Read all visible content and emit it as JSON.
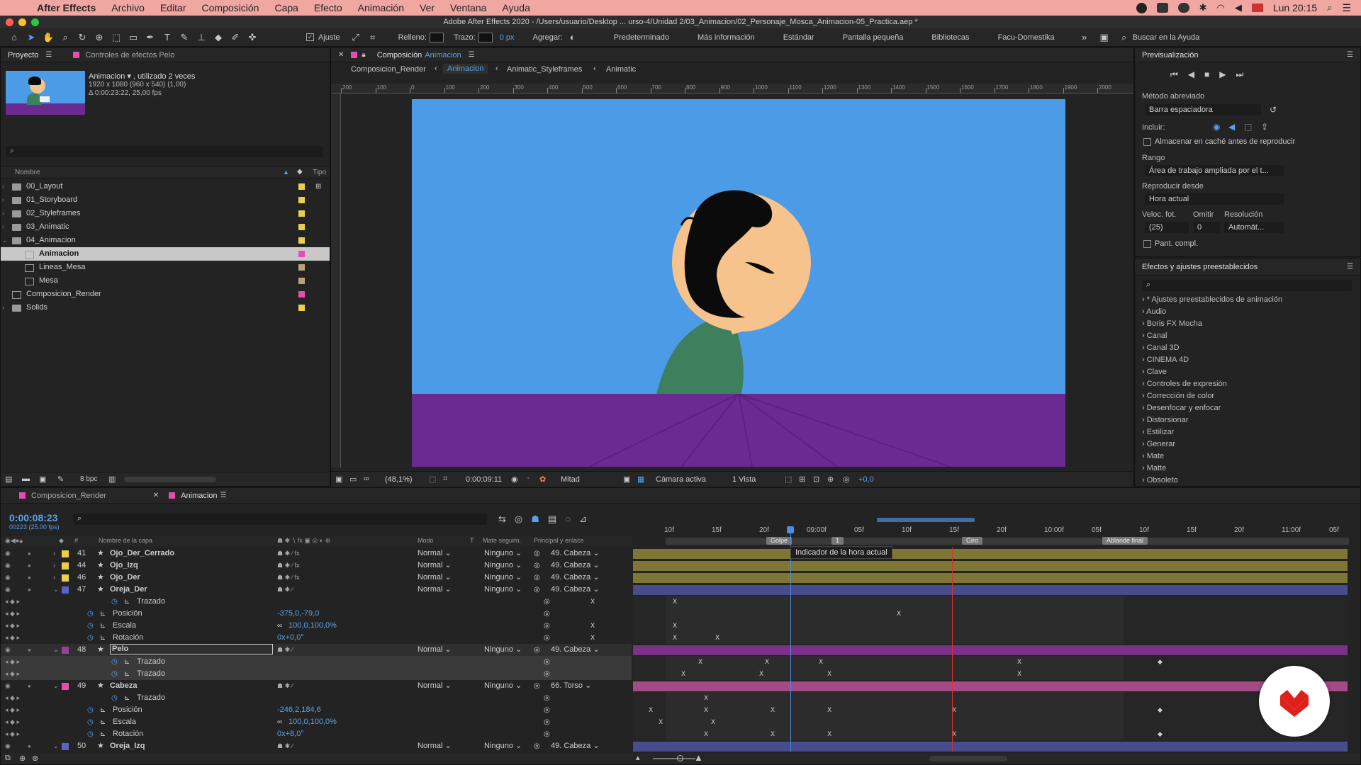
{
  "menubar": {
    "app": "After Effects",
    "items": [
      "Archivo",
      "Editar",
      "Composición",
      "Capa",
      "Efecto",
      "Animación",
      "Ver",
      "Ventana",
      "Ayuda"
    ],
    "clock": "Lun 20:15"
  },
  "titlebar": {
    "title": "Adobe After Effects 2020 - /Users/usuario/Desktop ... urso-4/Unidad 2/03_Animacion/02_Personaje_Mosca_Animacion-05_Practica.aep *"
  },
  "toolbar": {
    "ajuste": "Ajuste",
    "relleno": "Relleno:",
    "trazo": "Trazo:",
    "trazo_px": "0 px",
    "agregar": "Agregar:",
    "workspaces": [
      "Predeterminado",
      "Más información",
      "Estándar",
      "Pantalla pequeña",
      "Bibliotecas",
      "Facu-Domestika"
    ],
    "search_placeholder": "Buscar en la Ayuda"
  },
  "project": {
    "tab_project": "Proyecto",
    "tab_effects": "Controles de efectos Pelo",
    "selected_name": "Animacion ▾ , utilizado 2 veces",
    "selected_size": "1920 x 1080  (960 x 540) (1,00)",
    "selected_duration": "Δ 0:00:23:22, 25,00 fps",
    "col_name": "Nombre",
    "col_type": "Tipo",
    "bpc": "8 bpc",
    "items": [
      {
        "name": "00_Layout",
        "kind": "folder",
        "indent": 0,
        "color": "#e8d04c"
      },
      {
        "name": "01_Storyboard",
        "kind": "folder",
        "indent": 0,
        "color": "#e8d04c"
      },
      {
        "name": "02_Styleframes",
        "kind": "folder",
        "indent": 0,
        "color": "#e8d04c"
      },
      {
        "name": "03_Animatic",
        "kind": "folder",
        "indent": 0,
        "color": "#e8d04c"
      },
      {
        "name": "04_Animacion",
        "kind": "folder-open",
        "indent": 0,
        "color": "#e8d04c"
      },
      {
        "name": "Animacion",
        "kind": "comp",
        "indent": 1,
        "color": "#e64db2",
        "selected": true
      },
      {
        "name": "Lineas_Mesa",
        "kind": "comp",
        "indent": 1,
        "color": "#b8a37a"
      },
      {
        "name": "Mesa",
        "kind": "comp",
        "indent": 1,
        "color": "#b8a37a"
      },
      {
        "name": "Composicion_Render",
        "kind": "comp",
        "indent": 0,
        "color": "#e64db2"
      },
      {
        "name": "Solids",
        "kind": "folder",
        "indent": 0,
        "color": "#e8d04c"
      }
    ]
  },
  "viewer": {
    "tab_label": "Composición",
    "tab_comp": "Animacion",
    "crumbs": [
      "Composicion_Render",
      "Animacion",
      "Animatic_Styleframes",
      "Animatic"
    ],
    "ruler_labels": [
      "200",
      "100",
      "0",
      "100",
      "200",
      "300",
      "400",
      "500",
      "600",
      "700",
      "800",
      "900",
      "1000",
      "1100",
      "1200",
      "1300",
      "1400",
      "1500",
      "1600",
      "1700",
      "1800",
      "1900",
      "2000"
    ],
    "zoom": "(48,1%)",
    "timecode": "0:00:09:11",
    "resolution": "Mitad",
    "camera": "Cámara activa",
    "views": "1 Vista",
    "exposure": "+0,0",
    "colors": {
      "sky": "#4c9be6",
      "table": "#6a2a92",
      "skin": "#f5c38b",
      "hair": "#0b0b0b",
      "shirt": "#3e7f5e"
    }
  },
  "preview": {
    "title": "Previsualización",
    "metodo_label": "Método abreviado",
    "metodo_value": "Barra espaciadora",
    "incluir_label": "Incluir:",
    "cache_label": "Almacenar en caché antes de reproducir",
    "rango_label": "Rango",
    "rango_value": "Área de trabajo ampliada por el t...",
    "reproducir_label": "Reproducir desde",
    "reproducir_value": "Hora actual",
    "veloc_label": "Veloc. fot.",
    "omitir_label": "Omitir",
    "resolucion_label": "Resolución",
    "veloc_value": "(25)",
    "omitir_value": "0",
    "resolucion_value": "Automát...",
    "pant_label": "Pant. compl."
  },
  "effects": {
    "title": "Efectos y ajustes preestablecidos",
    "items": [
      "* Ajustes preestablecidos de animación",
      "Audio",
      "Boris FX Mocha",
      "Canal",
      "Canal 3D",
      "CINEMA 4D",
      "Clave",
      "Controles de expresión",
      "Corrección de color",
      "Desenfocar y enfocar",
      "Distorsionar",
      "Estilizar",
      "Generar",
      "Mate",
      "Matte",
      "Obsoleto"
    ]
  },
  "timeline": {
    "tabs": [
      "Composicion_Render",
      "Animacion"
    ],
    "timecode": "0:00:08:23",
    "frame_info": "00223 (25.00 fps)",
    "col_layer": "Nombre de la capa",
    "col_mode": "Modo",
    "col_t": "T",
    "col_matte": "Mate seguim.",
    "col_parent": "Principal y enlace",
    "ruler": [
      "10f",
      "15f",
      "20f",
      "09:00f",
      "05f",
      "10f",
      "15f",
      "20f",
      "10:00f",
      "05f",
      "10f",
      "15f",
      "20f",
      "11:00f",
      "05f"
    ],
    "markers": [
      "Golpe",
      "1",
      "Giro",
      "Ablande final"
    ],
    "tooltip": "Indicador de la hora actual",
    "rows": [
      {
        "num": "41",
        "name": "Ojo_Der_Cerrado",
        "color": "#e8d04c",
        "mode": "Normal",
        "matte": "Ninguno",
        "parent": "49. Cabeza",
        "type": "layer",
        "bar": "#7d7634"
      },
      {
        "num": "44",
        "name": "Ojo_Izq",
        "color": "#e8d04c",
        "mode": "Normal",
        "matte": "Ninguno",
        "parent": "49. Cabeza",
        "type": "layer",
        "bar": "#7d7634"
      },
      {
        "num": "46",
        "name": "Ojo_Der",
        "color": "#e8d04c",
        "mode": "Normal",
        "matte": "Ninguno",
        "parent": "49. Cabeza",
        "type": "layer",
        "bar": "#7d7634"
      },
      {
        "num": "47",
        "name": "Oreja_Der",
        "color": "#5a63c7",
        "mode": "Normal",
        "matte": "Ninguno",
        "parent": "49. Cabeza",
        "type": "layer",
        "bar": "#464c8c"
      },
      {
        "name": "Trazado",
        "type": "prop",
        "value": ""
      },
      {
        "name": "Posición",
        "type": "prop",
        "value": "-375,0,-79,0"
      },
      {
        "name": "Escala",
        "type": "prop",
        "value": "100,0,100,0%"
      },
      {
        "name": "Rotación",
        "type": "prop",
        "value": "0x+0,0°"
      },
      {
        "num": "48",
        "name": "Pelo",
        "color": "#9b3d9c",
        "mode": "Normal",
        "matte": "Ninguno",
        "parent": "49. Cabeza",
        "type": "layer",
        "bar": "#7a3188",
        "selected": true
      },
      {
        "name": "Trazado",
        "type": "prop",
        "value": "",
        "selected": true
      },
      {
        "name": "Trazado",
        "type": "prop",
        "value": "",
        "selected": true
      },
      {
        "num": "49",
        "name": "Cabeza",
        "color": "#e64db2",
        "mode": "Normal",
        "matte": "Ninguno",
        "parent": "66. Torso",
        "type": "layer",
        "bar": "#a44a86"
      },
      {
        "name": "Trazado",
        "type": "prop",
        "value": ""
      },
      {
        "name": "Posición",
        "type": "prop",
        "value": "-246,2,184,6"
      },
      {
        "name": "Escala",
        "type": "prop",
        "value": "100,0,100,0%"
      },
      {
        "name": "Rotación",
        "type": "prop",
        "value": "0x+8,0°"
      },
      {
        "num": "50",
        "name": "Oreja_Izq",
        "color": "#5a63c7",
        "mode": "Normal",
        "matte": "Ninguno",
        "parent": "49. Cabeza",
        "type": "layer",
        "bar": "#464c8c"
      }
    ]
  }
}
